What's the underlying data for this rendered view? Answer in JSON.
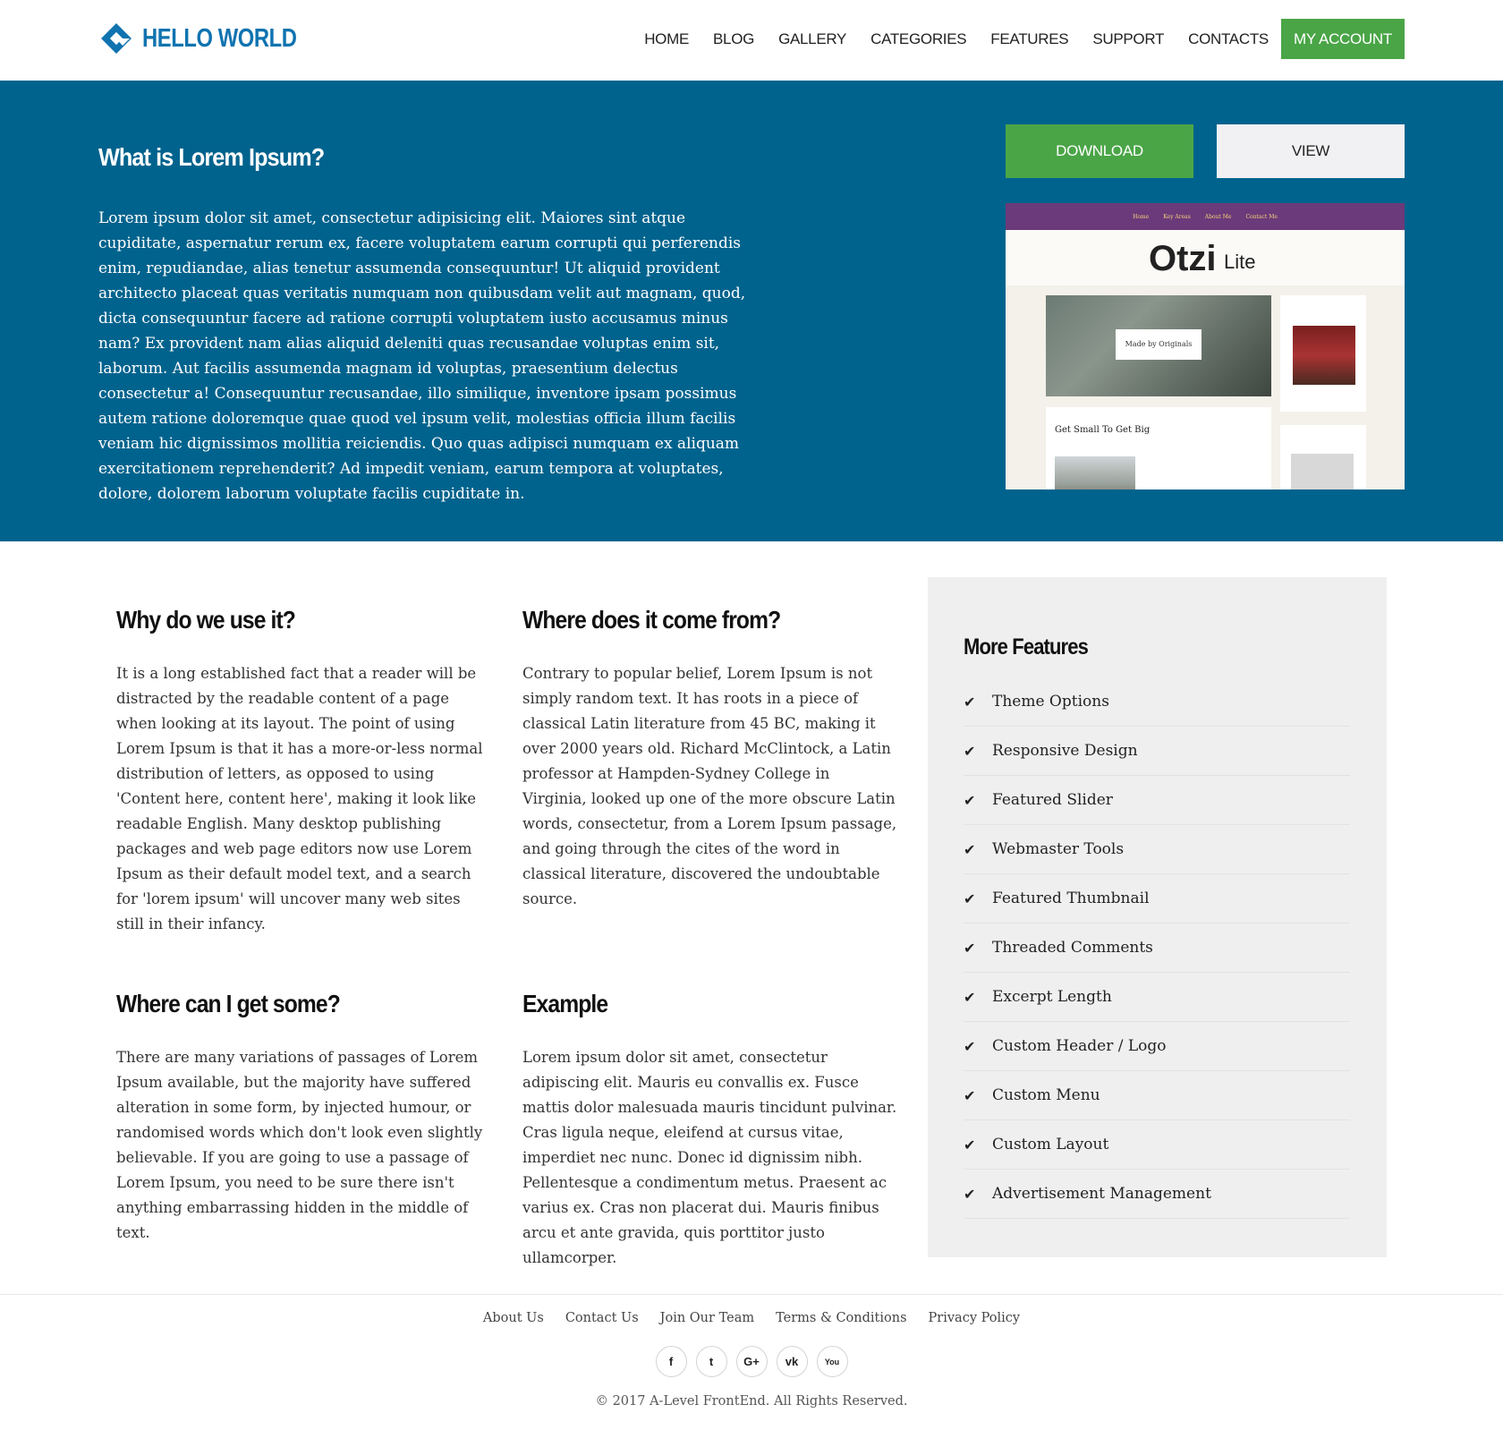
{
  "header": {
    "logo_text": "HELLO WORLD",
    "nav": [
      "HOME",
      "BLOG",
      "GALLERY",
      "CATEGORIES",
      "FEATURES",
      "SUPPORT",
      "CONTACTS"
    ],
    "account_label": "MY ACCOUNT"
  },
  "hero": {
    "title": "What is Lorem Ipsum?",
    "text": "Lorem ipsum dolor sit amet, consectetur adipisicing elit. Maiores sint atque cupiditate, aspernatur rerum ex, facere voluptatem earum corrupti qui perferendis enim, repudiandae, alias tenetur assumenda consequuntur! Ut aliquid provident architecto placeat quas veritatis numquam non quibusdam velit aut magnam, quod, dicta consequuntur facere ad ratione corrupti voluptatem iusto accusamus minus nam? Ex provident nam alias aliquid deleniti quas recusandae voluptas enim sit, laborum. Aut facilis assumenda magnam id voluptas, praesentium delectus consectetur a! Consequuntur recusandae, illo similique, inventore ipsam possimus autem ratione doloremque quae quod vel ipsum velit, molestias officia illum facilis veniam hic dignissimos mollitia reiciendis. Quo quas adipisci numquam ex aliquam exercitationem reprehenderit? Ad impedit veniam, earum tempora at voluptates, dolore, dolorem laborum voluptate facilis cupiditate in.",
    "download_label": "DOWNLOAD",
    "view_label": "VIEW",
    "preview": {
      "nav": [
        "Home",
        "Key Areas",
        "About Me",
        "Contact Me"
      ],
      "brand": "Otzi",
      "brand_suffix": "Lite",
      "photo_label": "Made by Originals",
      "card_title": "Get Small To Get Big"
    }
  },
  "sections": {
    "why": {
      "title": "Why do we use it?",
      "text": "It is a long established fact that a reader will be distracted by the readable content of a page when looking at its layout. The point of using Lorem Ipsum is that it has a more-or-less normal distribution of letters, as opposed to using 'Content here, content here', making it look like readable English. Many desktop publishing packages and web page editors now use Lorem Ipsum as their default model text, and a search for 'lorem ipsum' will uncover many web sites still in their infancy."
    },
    "where_from": {
      "title": "Where does it come from?",
      "text": "Contrary to popular belief, Lorem Ipsum is not simply random text. It has roots in a piece of classical Latin literature from 45 BC, making it over 2000 years old. Richard McClintock, a Latin professor at Hampden-Sydney College in Virginia, looked up one of the more obscure Latin words, consectetur, from a Lorem Ipsum passage, and going through the cites of the word in classical literature, discovered the undoubtable source."
    },
    "where_get": {
      "title": "Where can I get some?",
      "text": "There are many variations of passages of Lorem Ipsum available, but the majority have suffered alteration in some form, by injected humour, or randomised words which don't look even slightly believable. If you are going to use a passage of Lorem Ipsum, you need to be sure there isn't anything embarrassing hidden in the middle of text."
    },
    "example": {
      "title": "Example",
      "text": "Lorem ipsum dolor sit amet, consectetur adipiscing elit. Mauris eu convallis ex. Fusce mattis dolor malesuada mauris tincidunt pulvinar. Cras ligula neque, eleifend at cursus vitae, imperdiet nec nunc. Donec id dignissim nibh. Pellentesque a condimentum metus. Praesent ac varius ex. Cras non placerat dui. Mauris finibus arcu et ante gravida, quis porttitor justo ullamcorper."
    }
  },
  "sidebar": {
    "title": "More Features",
    "items": [
      "Theme Options",
      "Responsive Design",
      "Featured Slider",
      "Webmaster Tools",
      "Featured Thumbnail",
      "Threaded Comments",
      "Excerpt Length",
      "Custom Header / Logo",
      "Custom Menu",
      "Custom Layout",
      "Advertisement Management"
    ]
  },
  "footer": {
    "links": [
      "About Us",
      "Contact Us",
      "Join Our Team",
      "Terms & Conditions",
      "Privacy Policy"
    ],
    "social": [
      {
        "name": "facebook-icon",
        "glyph": "f"
      },
      {
        "name": "twitter-icon",
        "glyph": "t"
      },
      {
        "name": "google-plus-icon",
        "glyph": "G+"
      },
      {
        "name": "vk-icon",
        "glyph": "vk"
      },
      {
        "name": "youtube-icon",
        "glyph": "You"
      }
    ],
    "copyright": "© 2017 A-Level FrontEnd. All Rights Reserved."
  },
  "colors": {
    "brand_blue": "#0f73b0",
    "hero_bg": "#00638d",
    "accent_green": "#4aa547",
    "sidebar_bg": "#efefef"
  }
}
